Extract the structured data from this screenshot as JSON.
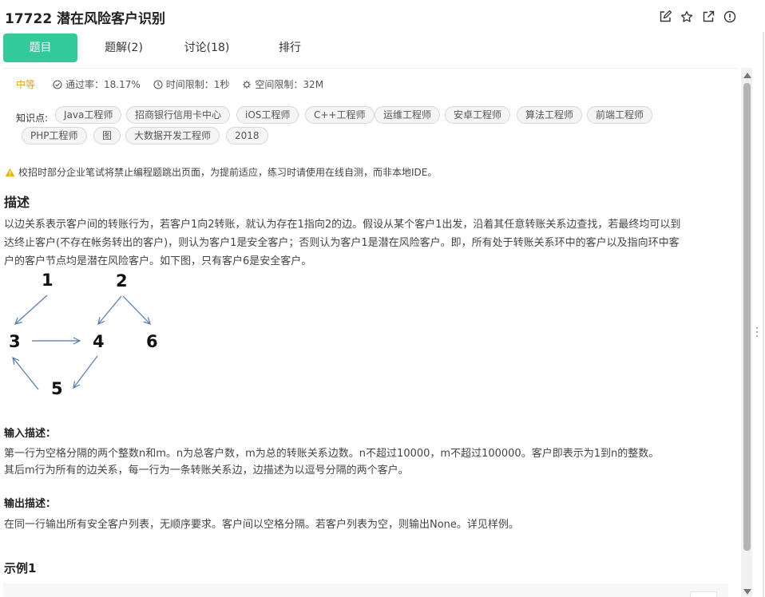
{
  "header": {
    "title": "17722  潜在风险客户识别",
    "icons": [
      "edit-icon",
      "star-icon",
      "share-icon",
      "report-icon"
    ]
  },
  "tabs": [
    {
      "label": "题目",
      "active": true
    },
    {
      "label": "题解(2)",
      "active": false
    },
    {
      "label": "讨论(18)",
      "active": false
    },
    {
      "label": "排行",
      "active": false
    }
  ],
  "meta": {
    "level": "中等",
    "pass_rate": "通过率：18.17%",
    "time_limit": "时间限制：1秒",
    "space_limit": "空间限制：32M"
  },
  "knowledge": {
    "label": "知识点:",
    "tags": [
      "Java工程师",
      "招商银行信用卡中心",
      "iOS工程师",
      "C++工程师",
      "运维工程师",
      "安卓工程师",
      "算法工程师",
      "前端工程师",
      "PHP工程师",
      "图",
      "大数据开发工程师",
      "2018"
    ]
  },
  "notice": "校招时部分企业笔试将禁止编程题跳出页面，为提前适应，练习时请使用在线自测，而非本地IDE。",
  "description": {
    "title": "描述",
    "line1": "以边关系表示客户间的转账行为，若客户1向2转账，就认为存在1指向2的边。假设从某个客户1出发，沿着其任意转账关系边查找，若最终均可以到",
    "line2": "达终止客户(不存在帐务转出的客户)，则认为客户1是安全客户；否则认为客户1是潜在风险客户。即，所有处于转账关系环中的客户以及指向环中客",
    "line3": "户的客户节点均是潜在风险客户。如下图，只有客户6是安全客户。",
    "graph_nodes": [
      "1",
      "2",
      "3",
      "4",
      "6",
      "5"
    ]
  },
  "input": {
    "title": "输入描述：",
    "line1": "第一行为空格分隔的两个整数n和m。n为总客户数，m为总的转账关系边数。n不超过10000，m不超过100000。客户即表示为1到n的整数。",
    "line2": "其后m行为所有的边关系，每一行为一条转账关系边，边描述为以逗号分隔的两个客户。"
  },
  "output": {
    "title": "输出描述：",
    "line1": "在同一行输出所有安全客户列表，无顺序要求。客户间以空格分隔。若客户列表为空，则输出None。详见样例。"
  },
  "example": {
    "title": "示例1"
  },
  "colors": {
    "accent": "#32ca99",
    "level": "#e5a100",
    "warning": "#f0b400",
    "arrow": "#4f79b5"
  }
}
